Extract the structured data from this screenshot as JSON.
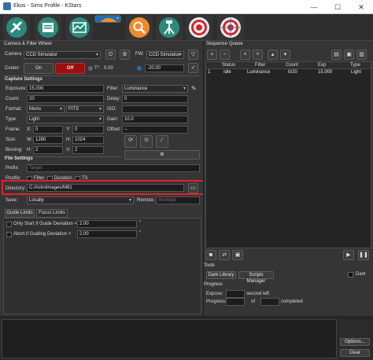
{
  "window": {
    "title": "Ekos - Sims Profile - KStars",
    "min": "—",
    "max": "☐",
    "close": "✕"
  },
  "modules": [
    "setup-icon",
    "scheduler-icon",
    "analyze-icon",
    "capture-icon",
    "focus-icon",
    "mount-icon",
    "align-icon",
    "guide-icon"
  ],
  "camera_fw": {
    "header": "Camera & Filter Wheel",
    "camera_label": "Camera",
    "camera_value": "CCD Simulator",
    "fw_label": "FW:",
    "fw_value": "CCD Simulator",
    "cooler_label": "Cooler:",
    "on_label": "On",
    "off_label": "Off",
    "temp_label": "T°:",
    "temp_value": "0.00",
    "temp_target": "-20.00"
  },
  "capture": {
    "header": "Capture Settings",
    "exposure_label": "Exposure:",
    "exposure_value": "15.000",
    "filter_label": "Filter:",
    "filter_value": "Luminance",
    "count_label": "Count:",
    "count_value": "20",
    "delay_label": "Delay:",
    "delay_value": "0",
    "format_label": "Format:",
    "format_value": "Mono",
    "format_value2": "FITS",
    "iso_label": "ISO:",
    "type_label": "Type:",
    "type_value": "Light",
    "gain_label": "Gain:",
    "gain_value": "10.0",
    "frame_label": "Frame:",
    "x_label": "X:",
    "x_value": "0",
    "y_label": "Y:",
    "y_value": "0",
    "offset_label": "Offset:",
    "offset_value": "--",
    "size_label": "Size:",
    "w_label": "W:",
    "w_value": "1280",
    "h_label": "H:",
    "h_value": "1024",
    "binning_label": "Binning:",
    "binh_label": "H:",
    "binh_value": "2",
    "binv_label": "V:",
    "binv_value": "2"
  },
  "file": {
    "header": "File Settings",
    "prefix_label": "Prefix:",
    "prefix_placeholder": "Target",
    "postfix_label": "Postfix:",
    "filter_chk": "Filter",
    "duration_chk": "Duration",
    "ts_chk": "TS",
    "directory_label": "Directory:",
    "directory_value": "C:/AstroImages/M81",
    "save_label": "Save:",
    "save_value": "Locally",
    "remote_label": "Remote:",
    "remote_placeholder": "/home/jo"
  },
  "limits": {
    "tab_guide": "Guide Limits",
    "tab_focus": "Focus Limits",
    "guide_dev_label": "Only Start if Guide Deviation <",
    "guide_dev_value": "2.00",
    "abort_label": "Abort if Guiding Deviation >",
    "abort_value": "2.00",
    "unit": "\""
  },
  "queue": {
    "header": "Sequence Queue",
    "columns": [
      "Status",
      "Filter",
      "Count",
      "Exp",
      "Type"
    ],
    "rows": [
      {
        "num": "1",
        "status": "Idle",
        "filter": "Luminance",
        "count": "0/20",
        "exp": "15.000",
        "type": "Light"
      }
    ]
  },
  "tools": {
    "header": "Tools",
    "dark_library": "Dark Library",
    "scripts_manager": "Scripts Manager",
    "dark_label": "Dark"
  },
  "progress": {
    "header": "Progress",
    "expose_label": "Expose:",
    "second_left": "second left",
    "progress_label": "Progress:",
    "of_label": "of",
    "completed": "completed"
  },
  "footer": {
    "options": "Options...",
    "clear": "Clear"
  },
  "colors": {
    "accent": "#1f6fb5",
    "highlight": "#e2212b",
    "off_red": "#9a1010"
  }
}
